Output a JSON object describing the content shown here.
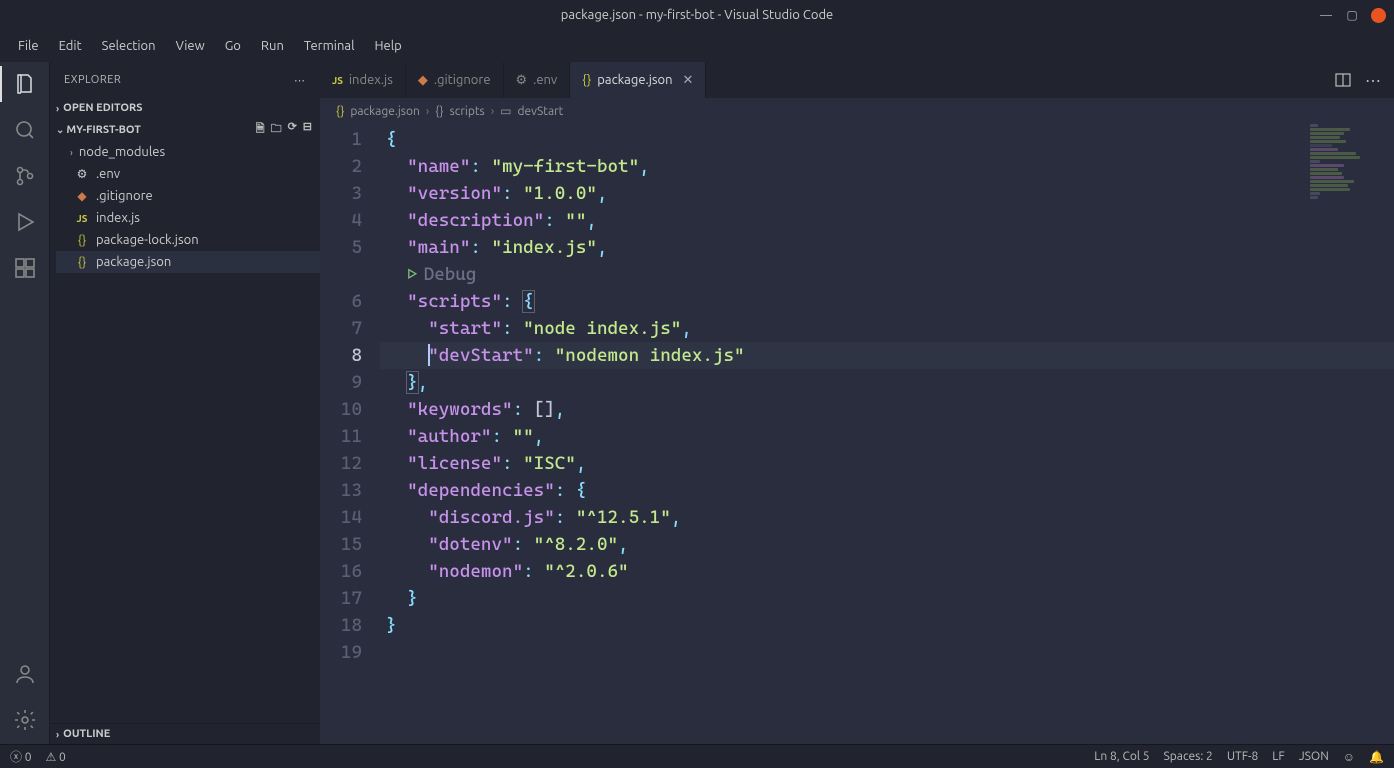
{
  "window": {
    "title": "package.json - my-first-bot - Visual Studio Code"
  },
  "menu": [
    "File",
    "Edit",
    "Selection",
    "View",
    "Go",
    "Run",
    "Terminal",
    "Help"
  ],
  "sidebar": {
    "title": "EXPLORER",
    "openEditors": "OPEN EDITORS",
    "project": "MY-FIRST-BOT",
    "outline": "OUTLINE",
    "tree": {
      "nodeModules": "node_modules",
      "env": ".env",
      "gitignore": ".gitignore",
      "indexjs": "index.js",
      "pkglock": "package-lock.json",
      "pkg": "package.json"
    }
  },
  "tabs": {
    "index": "index.js",
    "gitignore": ".gitignore",
    "env": ".env",
    "pkg": "package.json"
  },
  "breadcrumbs": {
    "file": "package.json",
    "scripts": "scripts",
    "devStart": "devStart"
  },
  "editor": {
    "debug": "Debug",
    "lines": {
      "l1": "{",
      "l2_key": "\"name\"",
      "l2_val": "\"my-first-bot\"",
      "l3_key": "\"version\"",
      "l3_val": "\"1.0.0\"",
      "l4_key": "\"description\"",
      "l4_val": "\"\"",
      "l5_key": "\"main\"",
      "l5_val": "\"index.js\"",
      "l6_key": "\"scripts\"",
      "l7_key": "\"start\"",
      "l7_val": "\"node index.js\"",
      "l8_key": "\"devStart\"",
      "l8_val": "\"nodemon index.js\"",
      "l9": "}",
      "l10_key": "\"keywords\"",
      "l10_val": "[]",
      "l11_key": "\"author\"",
      "l11_val": "\"\"",
      "l12_key": "\"license\"",
      "l12_val": "\"ISC\"",
      "l13_key": "\"dependencies\"",
      "l14_key": "\"discord.js\"",
      "l14_val": "\"^12.5.1\"",
      "l15_key": "\"dotenv\"",
      "l15_val": "\"^8.2.0\"",
      "l16_key": "\"nodemon\"",
      "l16_val": "\"^2.0.6\"",
      "l17": "}",
      "l18": "}"
    }
  },
  "status": {
    "errors": "0",
    "warnings": "0",
    "lncol": "Ln 8, Col 5",
    "spaces": "Spaces: 2",
    "encoding": "UTF-8",
    "eol": "LF",
    "lang": "JSON"
  }
}
